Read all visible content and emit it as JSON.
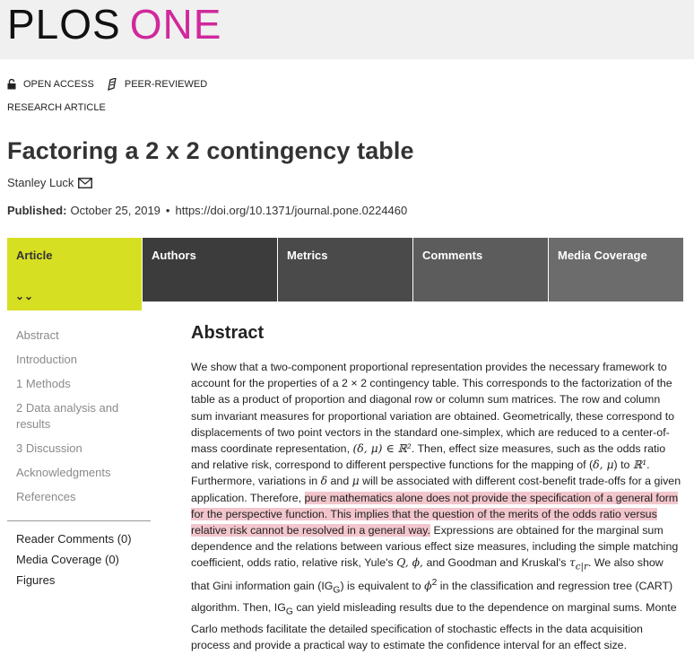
{
  "header": {
    "logo_part1": "PLOS",
    "logo_part2": "ONE",
    "colors": {
      "brand_magenta": "#d1289c",
      "tab_active": "#d7df23",
      "highlight": "#f2c6cc"
    }
  },
  "badges": {
    "open_access": "OPEN ACCESS",
    "peer_reviewed": "PEER-REVIEWED"
  },
  "article": {
    "type": "RESEARCH ARTICLE",
    "title": "Factoring a 2 x 2 contingency table",
    "author": "Stanley Luck",
    "published_label": "Published:",
    "published_date": "October 25, 2019",
    "doi": "https://doi.org/10.1371/journal.pone.0224460"
  },
  "tabs": [
    {
      "label": "Article",
      "active": true
    },
    {
      "label": "Authors"
    },
    {
      "label": "Metrics"
    },
    {
      "label": "Comments"
    },
    {
      "label": "Media Coverage"
    }
  ],
  "sidebar": {
    "sections": [
      "Abstract",
      "Introduction",
      "1 Methods",
      "2 Data analysis and results",
      "3 Discussion",
      "Acknowledgments",
      "References"
    ],
    "links": [
      "Reader Comments (0)",
      "Media Coverage (0)",
      "Figures"
    ]
  },
  "abstract": {
    "heading": "Abstract",
    "p1": "We show that a two-component proportional representation provides the necessary framework to account for the properties of a 2 × 2 contingency table. This corresponds to the factorization of the table as a product of proportion and diagonal row or column sum matrices. The row and column sum invariant measures for proportional variation are obtained. Geometrically, these correspond to displacements of two point vectors in the standard one-simplex, which are reduced to a center-of-mass coordinate representation, ",
    "m1": "(δ, μ) ∈ ℝ²",
    "p2": ". Then, effect size measures, such as the odds ratio and relative risk, correspond to different perspective functions for the mapping of (",
    "m2": "δ, μ",
    "p3": ") to ",
    "m3": "ℝ¹",
    "p4": ". Furthermore, variations in ",
    "m4": "δ",
    "p5": " and ",
    "m5": "μ",
    "p6": " will be associated with different cost-benefit trade-offs for a given application. Therefore, ",
    "highlight": "pure mathematics alone does not provide the specification of a general form for the perspective function. This implies that the question of the merits of the odds ratio versus relative risk cannot be resolved in a general way.",
    "p7": " Expressions are obtained for the marginal sum dependence and the relations between various effect size measures, including the simple matching coefficient, odds ratio, relative risk, Yule's ",
    "m6": "Q, ϕ,",
    "p8": " and Goodman and Kruskal's ",
    "m7": "τ",
    "m7sub": "c|r",
    "p9": ". We also show that Gini information gain (IG",
    "s1": "G",
    "p10": ") is equivalent to ",
    "m8": "ϕ",
    "m8sup": "2",
    "p11": " in the classification and regression tree (CART) algorithm. Then, IG",
    "s2": "G",
    "p12": " can yield misleading results due to the dependence on marginal sums. Monte Carlo methods facilitate the detailed specification of stochastic effects in the data acquisition process and provide a practical way to estimate the confidence interval for an effect size."
  }
}
